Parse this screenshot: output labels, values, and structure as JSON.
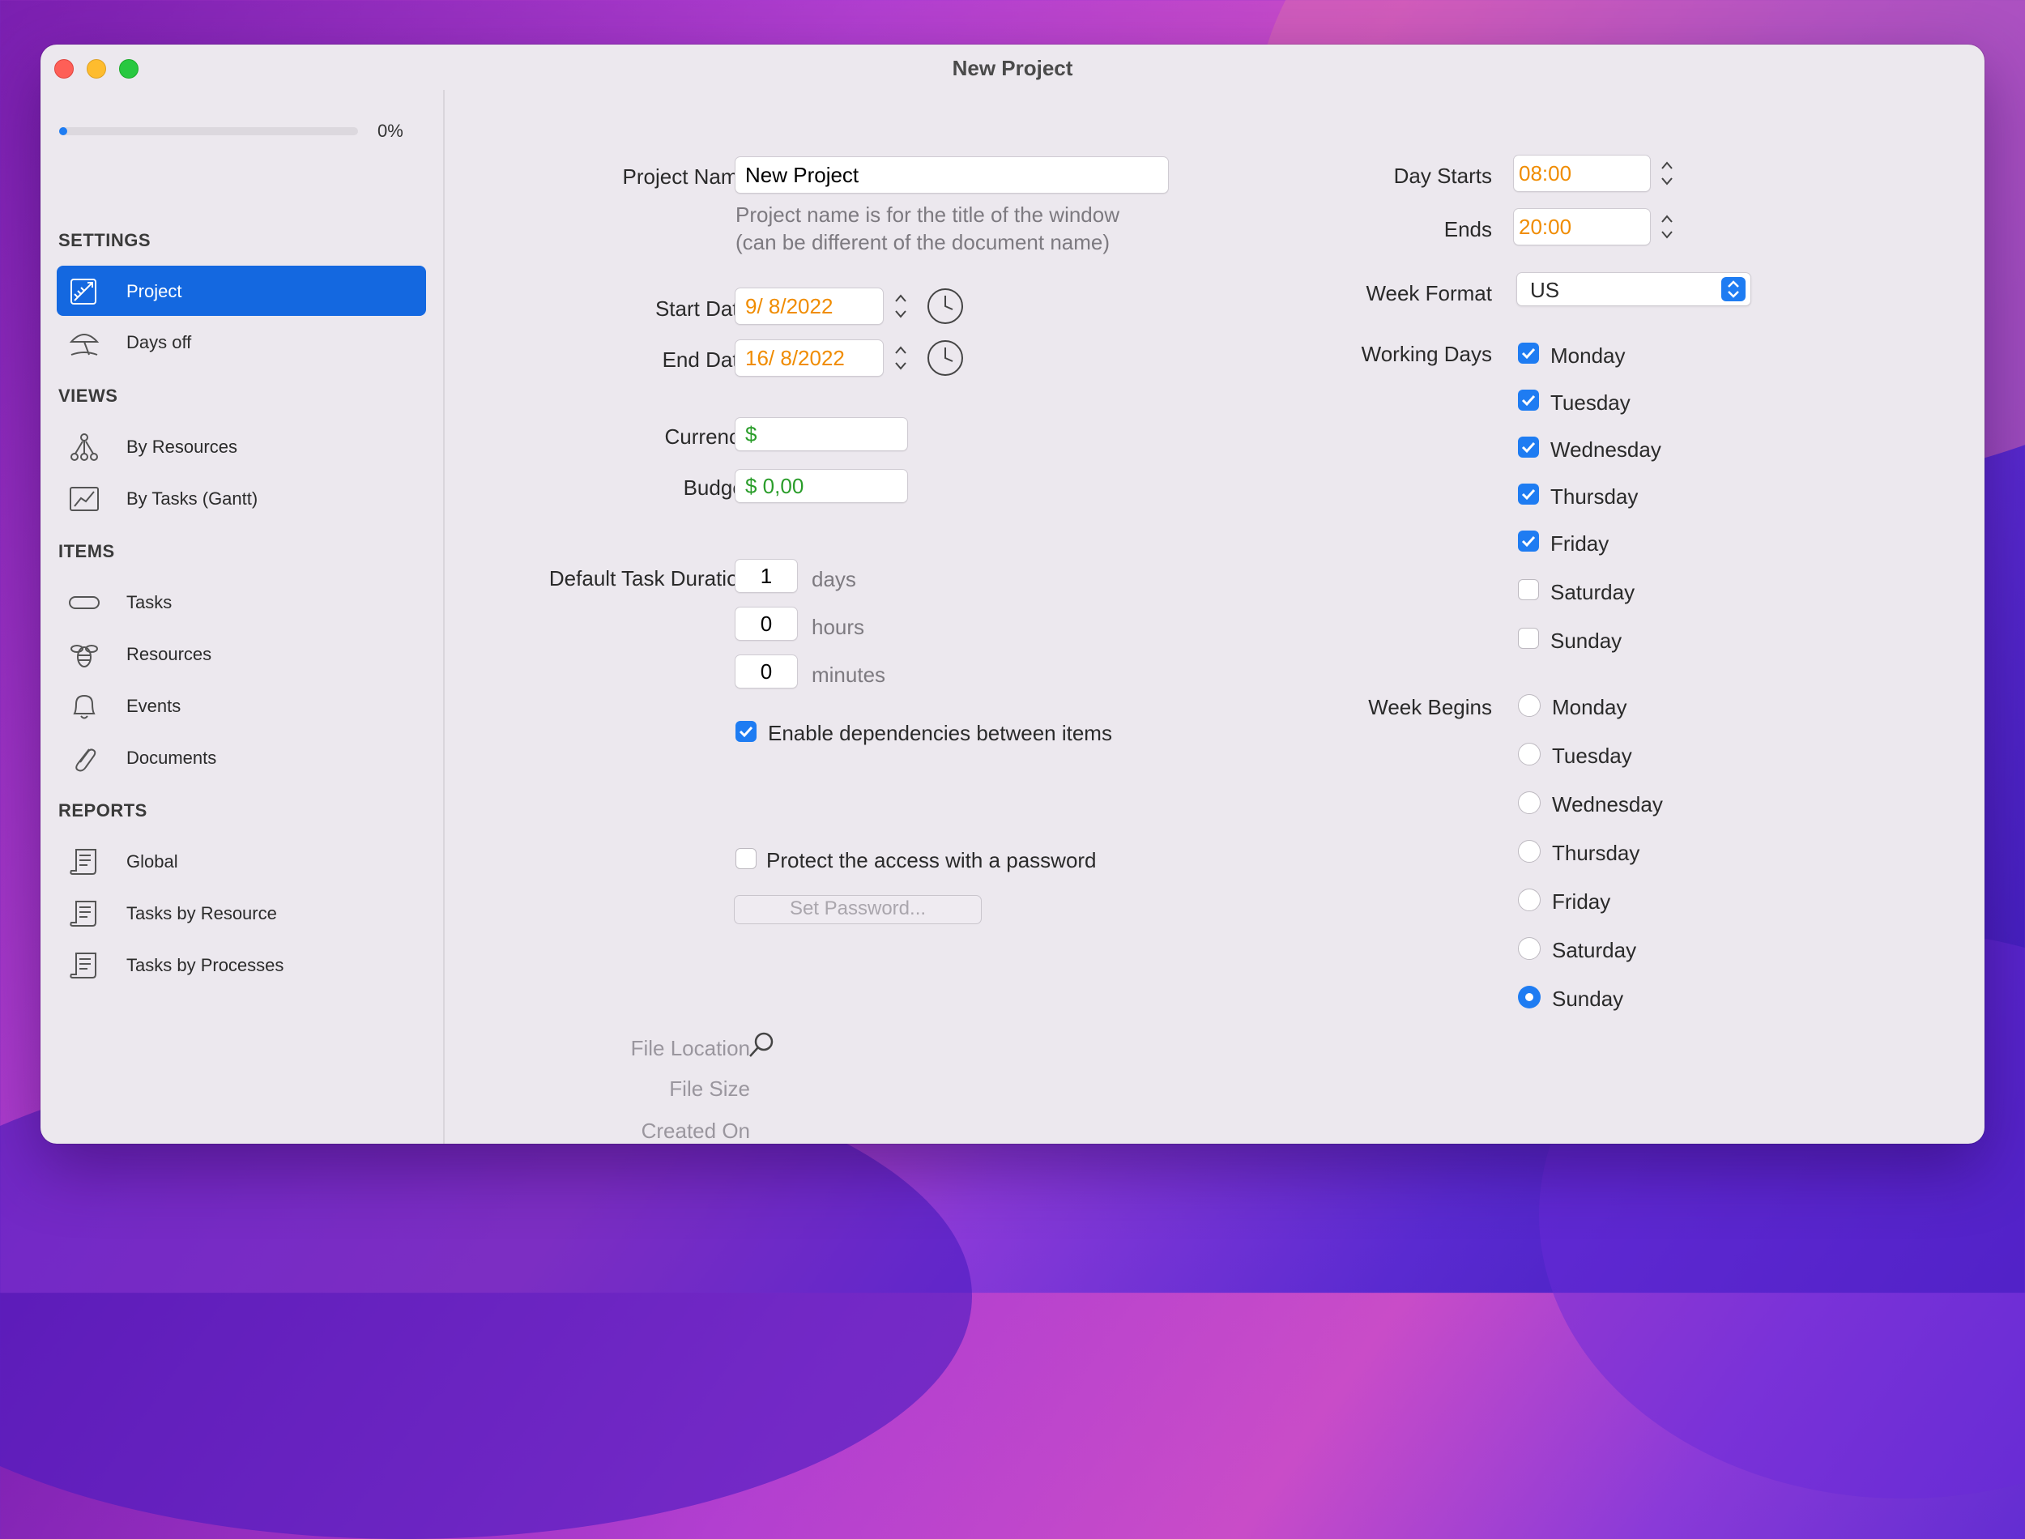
{
  "window": {
    "title": "New Project"
  },
  "sidebar": {
    "progress": {
      "value": 0.0,
      "label": "0%"
    },
    "sections": {
      "settings": "SETTINGS",
      "views": "VIEWS",
      "items": "ITEMS",
      "reports": "REPORTS"
    },
    "items": {
      "project": "Project",
      "days_off": "Days off",
      "by_resources": "By Resources",
      "by_tasks": "By Tasks (Gantt)",
      "tasks": "Tasks",
      "resources": "Resources",
      "events": "Events",
      "documents": "Documents",
      "global": "Global",
      "tasks_by_resource": "Tasks by Resource",
      "tasks_by_processes": "Tasks by Processes"
    },
    "selected": "project"
  },
  "form": {
    "project_name": {
      "label": "Project Name",
      "value": "New Project",
      "hint_line1": "Project name is for the title of the window",
      "hint_line2": "(can be different of the document name)"
    },
    "start_date": {
      "label": "Start Date",
      "value": "9/  8/2022"
    },
    "end_date": {
      "label": "End Date",
      "value": "16/  8/2022"
    },
    "currency": {
      "label": "Currency",
      "value": "$"
    },
    "budget": {
      "label": "Budget",
      "value": "$ 0,00"
    },
    "default_duration": {
      "label": "Default Task Duration",
      "days": {
        "value": "1",
        "unit": "days"
      },
      "hours": {
        "value": "0",
        "unit": "hours"
      },
      "minutes": {
        "value": "0",
        "unit": "minutes"
      }
    },
    "enable_dependencies": {
      "label": "Enable dependencies between items",
      "checked": true
    },
    "protect_password": {
      "label": "Protect the access with a password",
      "checked": false
    },
    "set_password_button": "Set Password...",
    "file_location": "File Location",
    "file_size": "File Size",
    "created_on": "Created On"
  },
  "schedule": {
    "day_starts": {
      "label": "Day Starts",
      "value": "08:00"
    },
    "ends": {
      "label": "Ends",
      "value": "20:00"
    },
    "week_format": {
      "label": "Week Format",
      "value": "US"
    },
    "working_days": {
      "label": "Working Days",
      "days": [
        {
          "name": "Monday",
          "checked": true
        },
        {
          "name": "Tuesday",
          "checked": true
        },
        {
          "name": "Wednesday",
          "checked": true
        },
        {
          "name": "Thursday",
          "checked": true
        },
        {
          "name": "Friday",
          "checked": true
        },
        {
          "name": "Saturday",
          "checked": false
        },
        {
          "name": "Sunday",
          "checked": false
        }
      ]
    },
    "week_begins": {
      "label": "Week Begins",
      "options": [
        "Monday",
        "Tuesday",
        "Wednesday",
        "Thursday",
        "Friday",
        "Saturday",
        "Sunday"
      ],
      "selected": "Sunday"
    }
  },
  "colors": {
    "accent": "#1e7cf2",
    "time_text": "#f08c00",
    "money_text": "#2a9d2a"
  }
}
